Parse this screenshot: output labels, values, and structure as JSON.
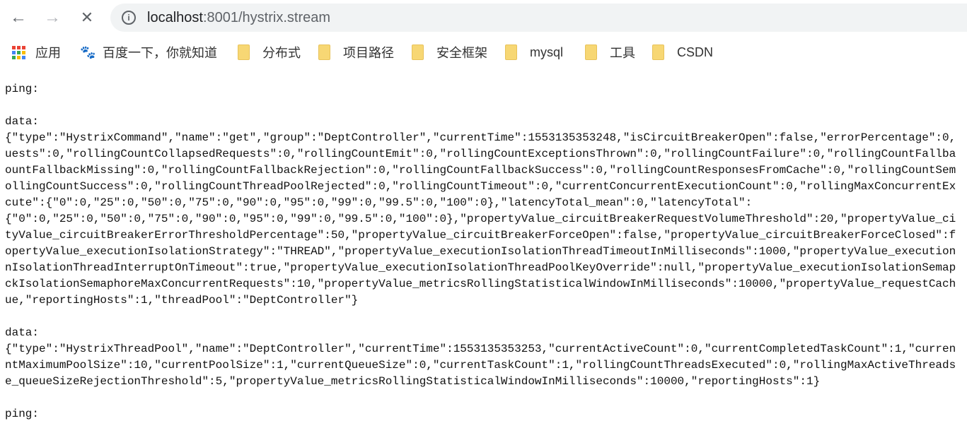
{
  "browser": {
    "url_host": "localhost",
    "url_rest": ":8001/hystrix.stream",
    "back": "←",
    "forward": "→",
    "stop": "✕"
  },
  "bookmarks": [
    {
      "label": "应用",
      "icon": "apps-grid-icon"
    },
    {
      "label": "百度一下，你就知道",
      "icon": "baidu-paw-icon"
    },
    {
      "label": "分布式",
      "icon": "folder-icon"
    },
    {
      "label": "项目路径",
      "icon": "folder-icon"
    },
    {
      "label": "安全框架",
      "icon": "folder-icon"
    },
    {
      "label": "mysql",
      "icon": "folder-icon"
    },
    {
      "label": "工具",
      "icon": "folder-icon"
    },
    {
      "label": "CSDN",
      "icon": "folder-icon"
    }
  ],
  "stream": {
    "ping1": "ping:",
    "data1_label": "data:",
    "data1_lines": [
      "{\"type\":\"HystrixCommand\",\"name\":\"get\",\"group\":\"DeptController\",\"currentTime\":1553135353248,\"isCircuitBreakerOpen\":false,\"errorPercentage\":0,",
      "uests\":0,\"rollingCountCollapsedRequests\":0,\"rollingCountEmit\":0,\"rollingCountExceptionsThrown\":0,\"rollingCountFailure\":0,\"rollingCountFallba",
      "ountFallbackMissing\":0,\"rollingCountFallbackRejection\":0,\"rollingCountFallbackSuccess\":0,\"rollingCountResponsesFromCache\":0,\"rollingCountSem",
      "ollingCountSuccess\":0,\"rollingCountThreadPoolRejected\":0,\"rollingCountTimeout\":0,\"currentConcurrentExecutionCount\":0,\"rollingMaxConcurrentEx",
      "cute\":{\"0\":0,\"25\":0,\"50\":0,\"75\":0,\"90\":0,\"95\":0,\"99\":0,\"99.5\":0,\"100\":0},\"latencyTotal_mean\":0,\"latencyTotal\":",
      "{\"0\":0,\"25\":0,\"50\":0,\"75\":0,\"90\":0,\"95\":0,\"99\":0,\"99.5\":0,\"100\":0},\"propertyValue_circuitBreakerRequestVolumeThreshold\":20,\"propertyValue_ci",
      "tyValue_circuitBreakerErrorThresholdPercentage\":50,\"propertyValue_circuitBreakerForceOpen\":false,\"propertyValue_circuitBreakerForceClosed\":f",
      "opertyValue_executionIsolationStrategy\":\"THREAD\",\"propertyValue_executionIsolationThreadTimeoutInMilliseconds\":1000,\"propertyValue_execution",
      "nIsolationThreadInterruptOnTimeout\":true,\"propertyValue_executionIsolationThreadPoolKeyOverride\":null,\"propertyValue_executionIsolationSemap",
      "ckIsolationSemaphoreMaxConcurrentRequests\":10,\"propertyValue_metricsRollingStatisticalWindowInMilliseconds\":10000,\"propertyValue_requestCach",
      "ue,\"reportingHosts\":1,\"threadPool\":\"DeptController\"}"
    ],
    "data2_label": "data:",
    "data2_lines": [
      "{\"type\":\"HystrixThreadPool\",\"name\":\"DeptController\",\"currentTime\":1553135353253,\"currentActiveCount\":0,\"currentCompletedTaskCount\":1,\"curren",
      "ntMaximumPoolSize\":10,\"currentPoolSize\":1,\"currentQueueSize\":0,\"currentTaskCount\":1,\"rollingCountThreadsExecuted\":0,\"rollingMaxActiveThreads",
      "e_queueSizeRejectionThreshold\":5,\"propertyValue_metricsRollingStatisticalWindowInMilliseconds\":10000,\"reportingHosts\":1}"
    ],
    "ping2": "ping:"
  }
}
